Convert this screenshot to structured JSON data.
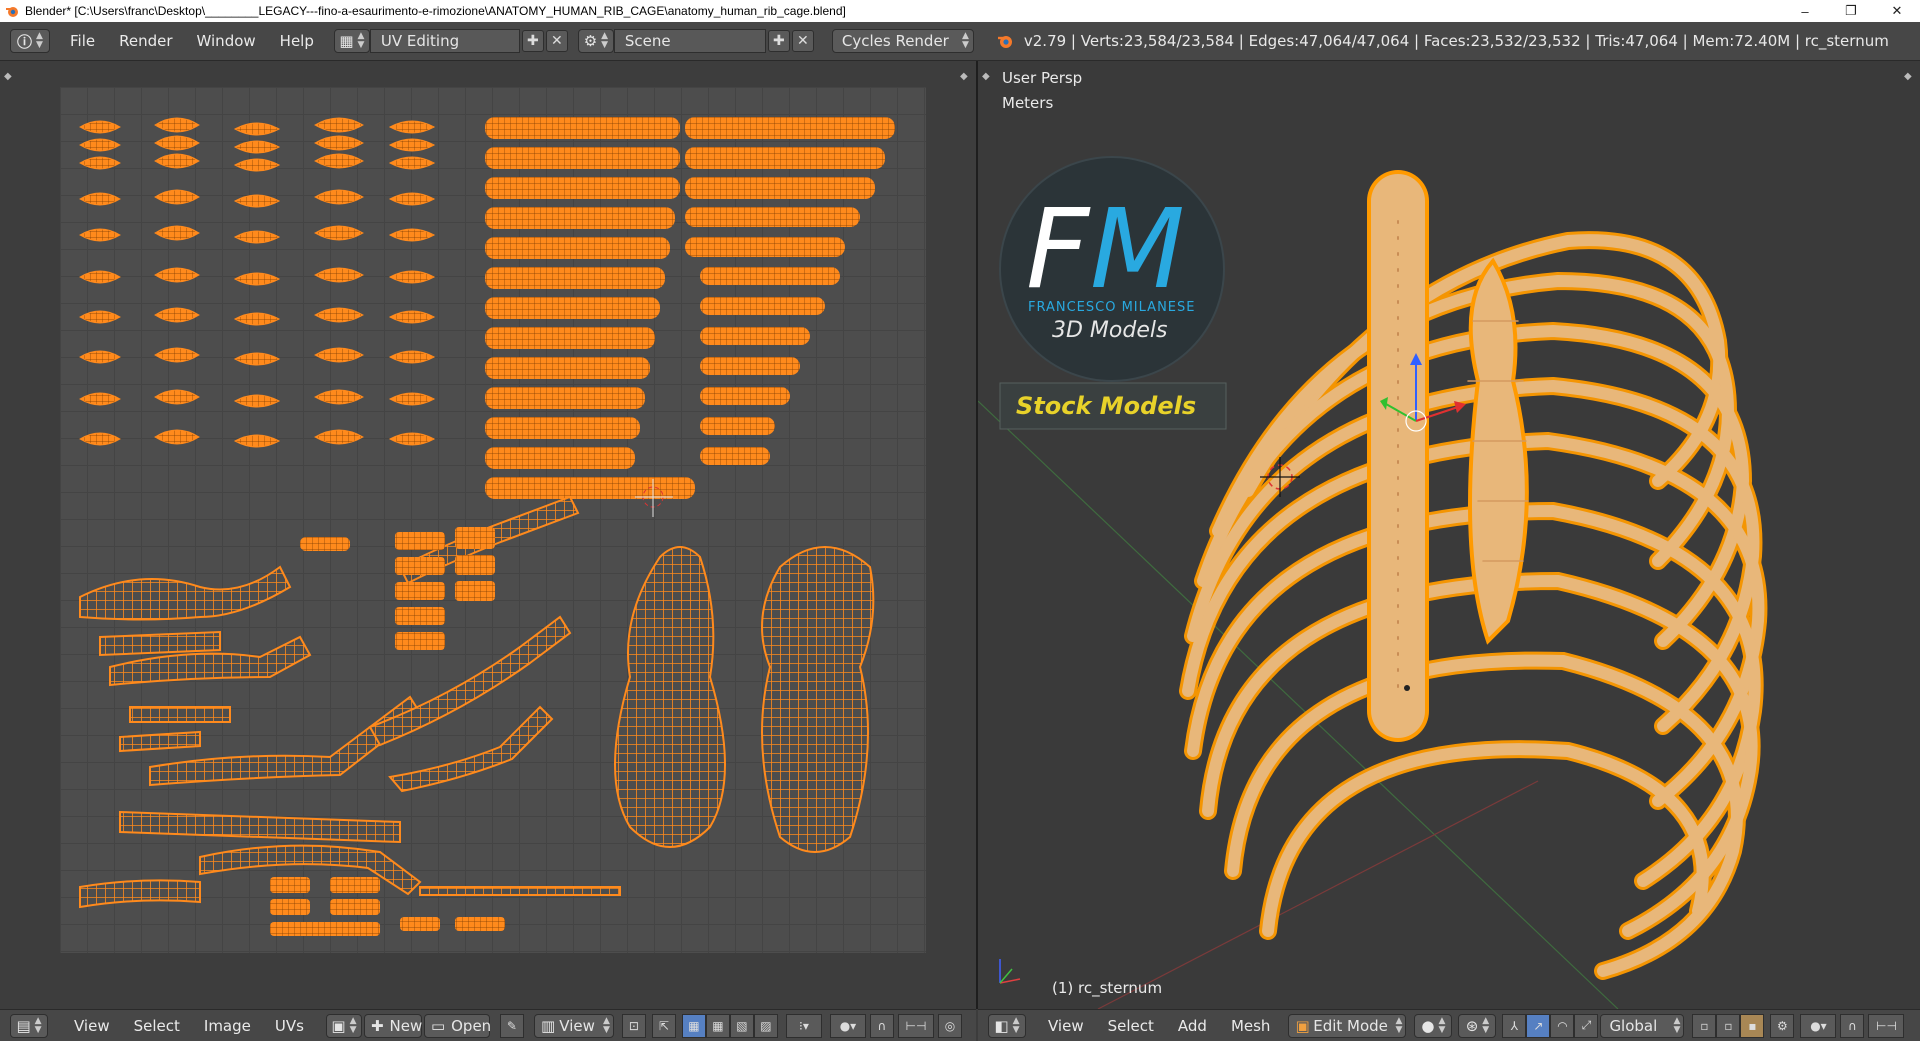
{
  "window": {
    "title": "Blender* [C:\\Users\\franc\\Desktop\\________LEGACY---fino-a-esaurimento-e-rimozione\\ANATOMY_HUMAN_RIB_CAGE\\anatomy_human_rib_cage.blend]",
    "controls": [
      "–",
      "❐",
      "✕"
    ]
  },
  "info_header": {
    "menus": [
      "File",
      "Render",
      "Window",
      "Help"
    ],
    "screen_layout": "UV Editing",
    "scene": "Scene",
    "render_engine": "Cycles Render",
    "stats": "v2.79 | Verts:23,584/23,584 | Edges:47,064/47,064 | Faces:23,532/23,532 | Tris:47,064 | Mem:72.40M | rc_sternum"
  },
  "viewport": {
    "view_name": "User Persp",
    "units": "Meters",
    "object_label": "(1) rc_sternum",
    "logo": {
      "monogram_f": "F",
      "monogram_m": "M",
      "author": "FRANCESCO MILANESE",
      "subtitle": "3D Models",
      "banner": "Stock Models"
    }
  },
  "uv_footer": {
    "menus": [
      "View",
      "Select",
      "Image",
      "UVs"
    ],
    "new_label": "New",
    "open_label": "Open",
    "view_label": "View"
  },
  "view3d_footer": {
    "menus": [
      "View",
      "Select",
      "Add",
      "Mesh"
    ],
    "mode": "Edit Mode",
    "orientation": "Global"
  },
  "colors": {
    "uv_island": "#ff8a1c",
    "bone": "#e8b77a",
    "wire": "#ff9a00",
    "logo_blue": "#29a9e0",
    "banner_text": "#e8d22a"
  }
}
